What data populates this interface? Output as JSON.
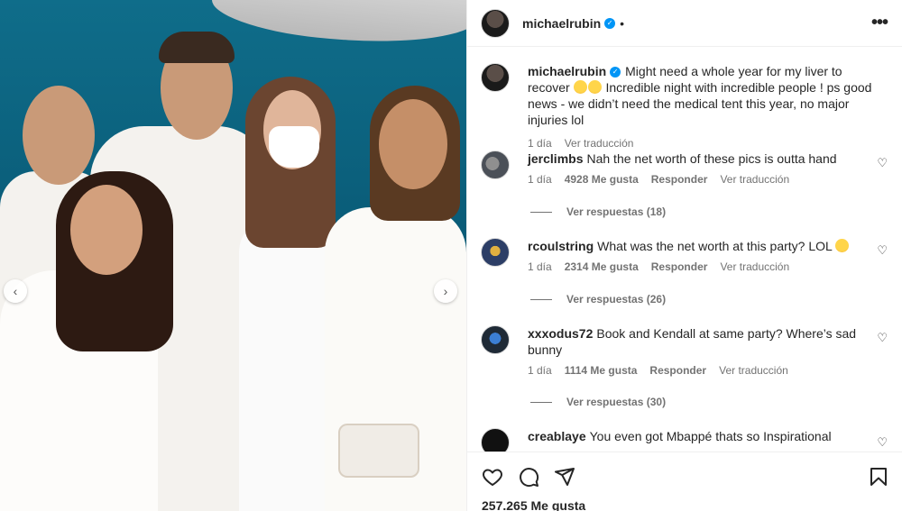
{
  "post": {
    "author": "michaelrubin",
    "dot": "•",
    "more_glyph": "•••"
  },
  "caption": {
    "username": "michaelrubin",
    "text_before_emoji": "Might need a whole year for my liver to recover",
    "emoji": [
      "joy-emoji",
      "joy-emoji"
    ],
    "text_after_emoji": "Incredible night with incredible people ! ps good news - we didn’t need the medical tent this year, no major injuries lol",
    "time": "1 día",
    "translate": "Ver traducción"
  },
  "comments": [
    {
      "username": "jerclimbs",
      "text": "Nah the net worth of these pics is outta hand",
      "time": "1 día",
      "likes": "4928 Me gusta",
      "reply": "Responder",
      "translate": "Ver traducción",
      "replies": "Ver respuestas (18)"
    },
    {
      "username": "rcoulstring",
      "text": "What was the net worth at this party? LOL",
      "emoji_after": "rofl-emoji",
      "time": "1 día",
      "likes": "2314 Me gusta",
      "reply": "Responder",
      "translate": "Ver traducción",
      "replies": "Ver respuestas (26)"
    },
    {
      "username": "xxxodus72",
      "text": "Book and Kendall at same party? Where’s sad bunny",
      "time": "1 día",
      "likes": "1114 Me gusta",
      "reply": "Responder",
      "translate": "Ver traducción",
      "replies": "Ver respuestas (30)"
    },
    {
      "username": "creablaye",
      "text": "You even got Mbappé thats so Inspirational"
    }
  ],
  "likes_count": "257.265 Me gusta",
  "icons": {
    "carousel_prev": "‹",
    "carousel_next": "›",
    "heart": "♡"
  },
  "colors": {
    "verified": "#0095f6",
    "text": "#262626",
    "secondary": "#737373",
    "photo_background": "#0a5c78"
  }
}
